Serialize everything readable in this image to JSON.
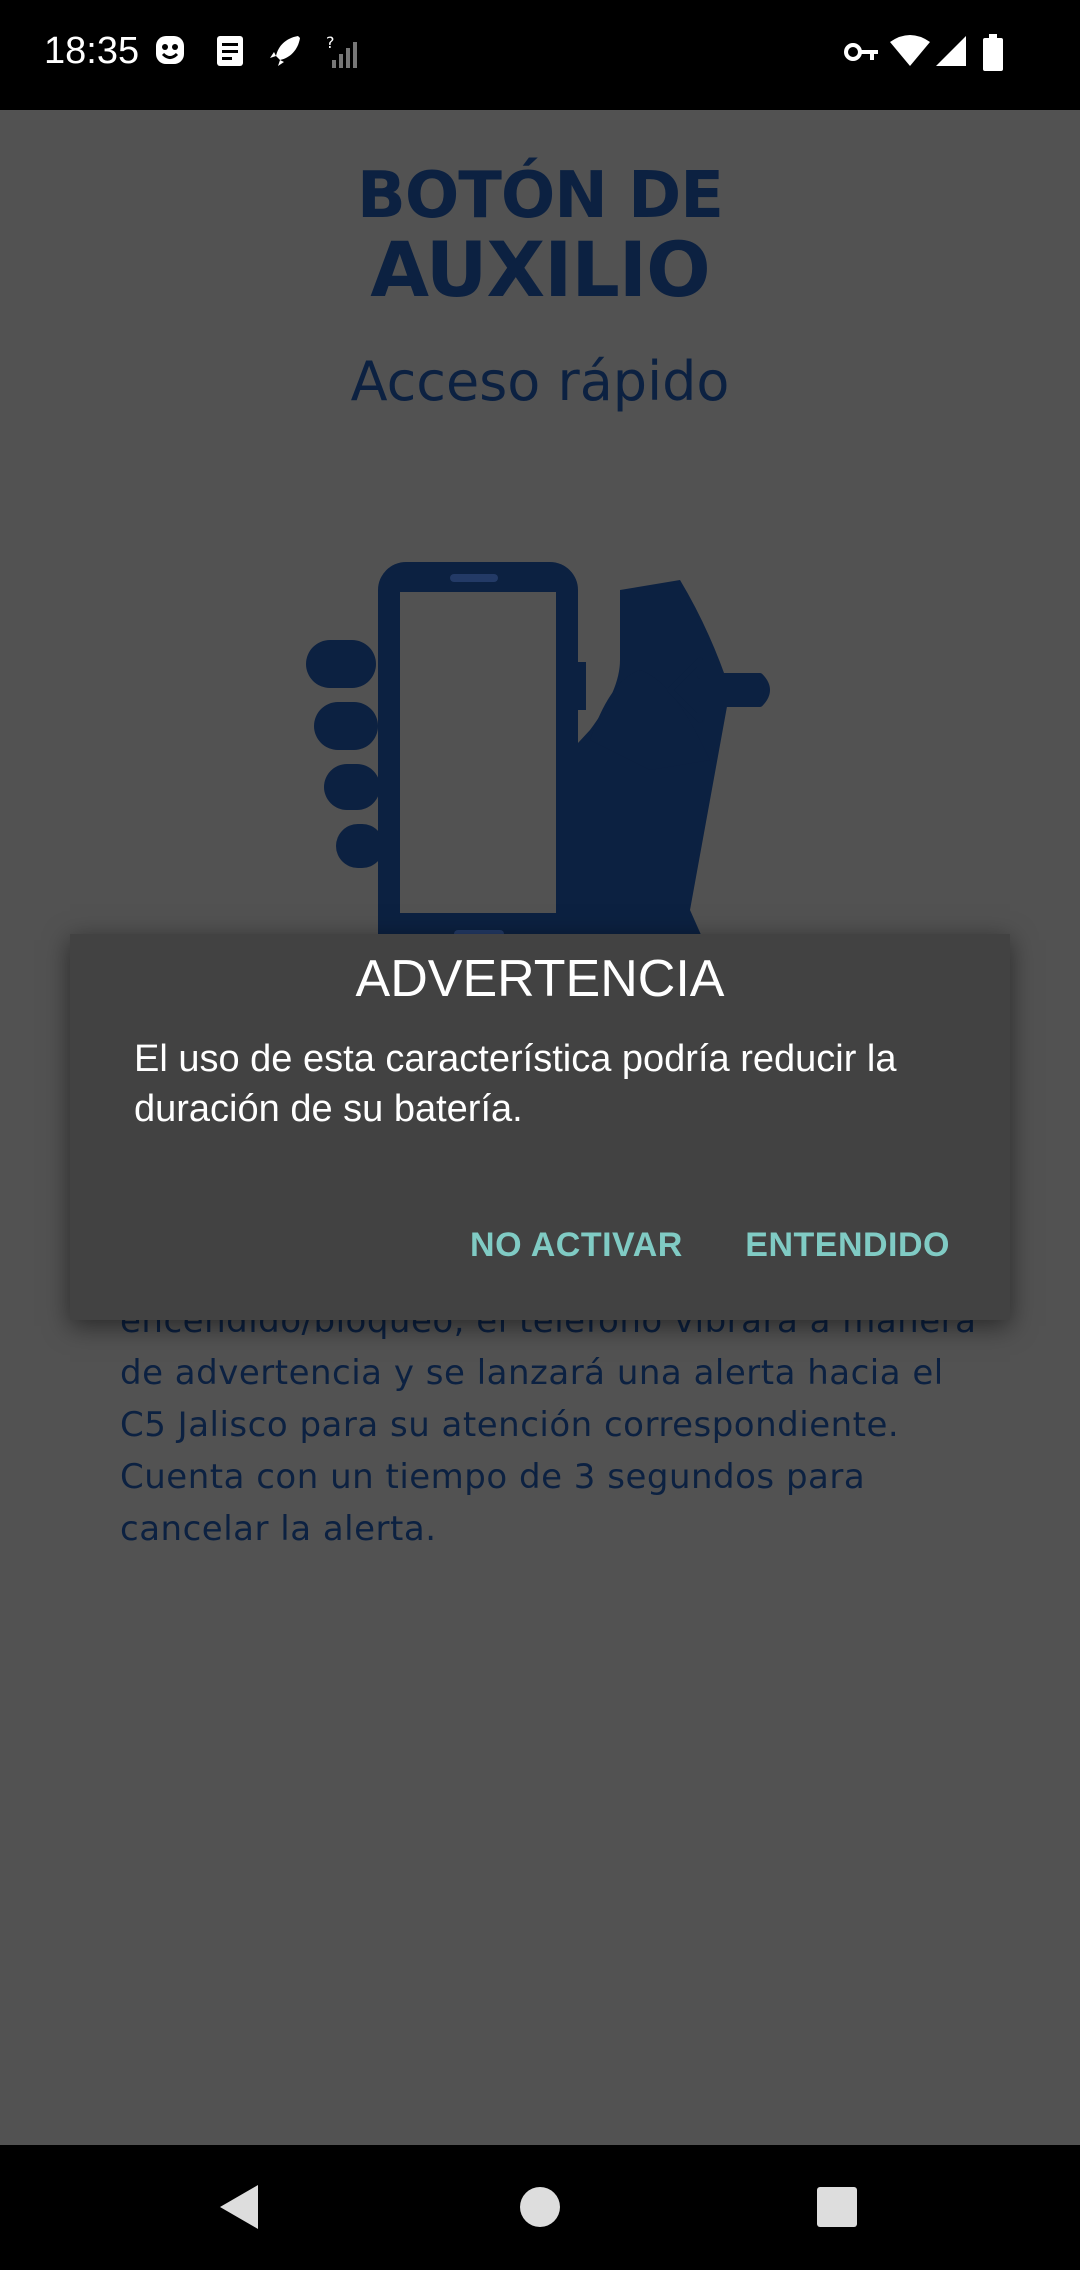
{
  "status_bar": {
    "time": "18:35",
    "left_icons": [
      "smiley-icon",
      "notes-icon",
      "rocket-icon",
      "signal-unknown-icon"
    ],
    "right_icons": [
      "vpn-key-icon",
      "wifi-icon",
      "cell-signal-icon",
      "battery-icon"
    ]
  },
  "app": {
    "logo_line1": "BOTÓN DE",
    "logo_line2": "AUXILIO",
    "subtitle": "Acceso rápido",
    "illustration": "hand-holding-phone-icon",
    "body_text": "encendido/bloqueo, el teléfono vibrará a manera de advertencia y se lanzará una alerta hacia el C5 Jalisco para su atención correspondiente. Cuenta con un tiempo de 3 segundos para cancelar la alerta."
  },
  "dialog": {
    "title": "ADVERTENCIA",
    "message": "El uso de esta característica podría reducir la duración de su batería.",
    "negative_label": "NO ACTIVAR",
    "positive_label": "ENTENDIDO"
  },
  "nav": {
    "icons": [
      "back-icon",
      "home-icon",
      "recents-icon"
    ]
  },
  "colors": {
    "scrim_background": "#525252",
    "brand_navy": "#0c2141",
    "dialog_background": "#424242",
    "dialog_accent": "#80cbc4"
  }
}
